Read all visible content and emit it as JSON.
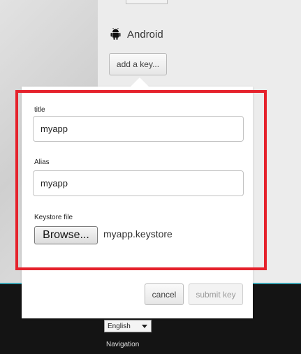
{
  "platform": {
    "name": "Android",
    "icon": "android-icon"
  },
  "add_key_button": {
    "label": "add a key..."
  },
  "form": {
    "title_label": "title",
    "title_value": "myapp",
    "alias_label": "Alias",
    "alias_value": "myapp",
    "keystore_label": "Keystore file",
    "browse_label": "Browse...",
    "keystore_filename": "myapp.keystore"
  },
  "actions": {
    "cancel_label": "cancel",
    "submit_label": "submit key"
  },
  "footer": {
    "language": "English",
    "navigation_label": "Navigation"
  },
  "colors": {
    "highlight": "#e5222c",
    "accent_line": "#3aa3b3",
    "footer_bg": "#141414"
  }
}
